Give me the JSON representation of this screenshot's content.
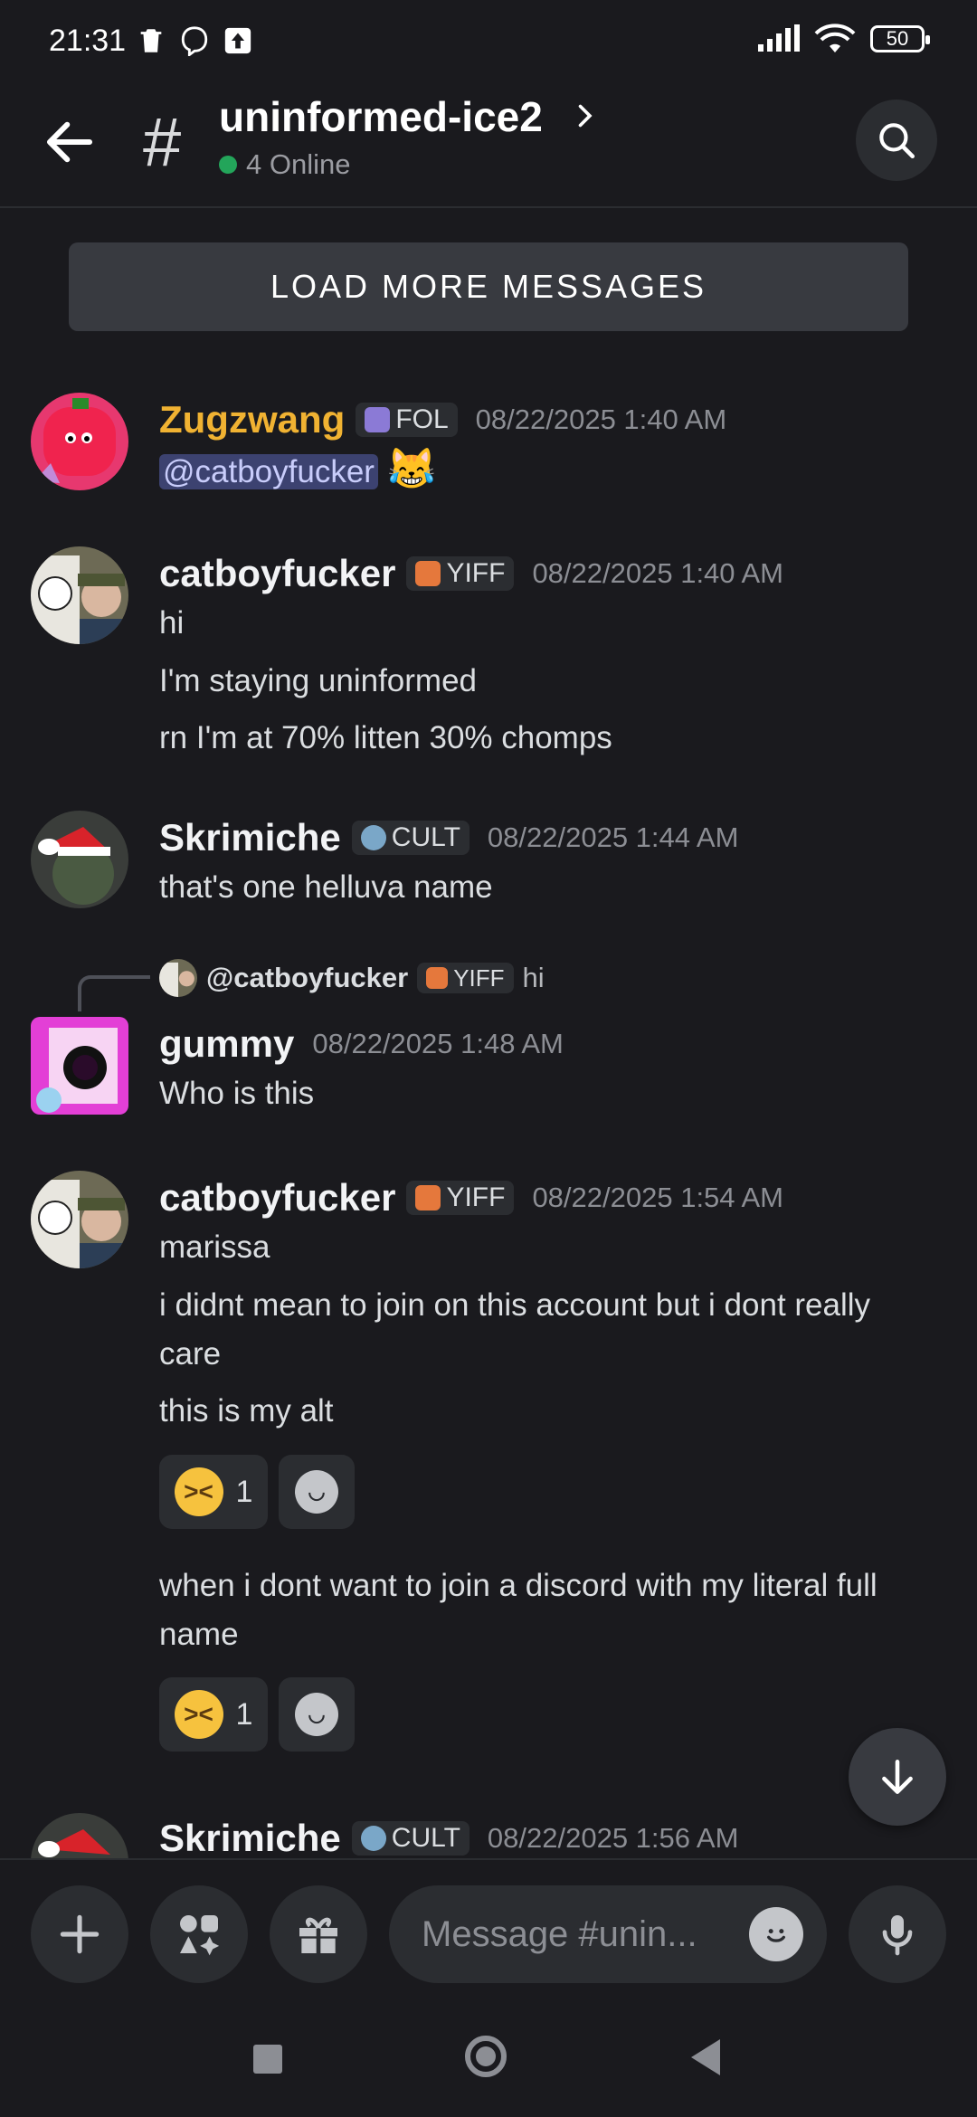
{
  "status": {
    "time": "21:31",
    "battery": "50"
  },
  "header": {
    "hash": "#",
    "channel": "uninformed-ice2",
    "online": "4 Online"
  },
  "load_more": "LOAD MORE MESSAGES",
  "messages": [
    {
      "user": "Zugzwang",
      "tag": "FOL",
      "time": "08/22/2025 1:40 AM",
      "mention": "@catboyfucker",
      "emoji": "😹"
    },
    {
      "user": "catboyfucker",
      "tag": "YIFF",
      "time": "08/22/2025 1:40 AM",
      "lines": [
        "hi",
        "I'm staying uninformed",
        "rn I'm at 70% litten 30% chomps"
      ]
    },
    {
      "user": "Skrimiche",
      "tag": "CULT",
      "time": "08/22/2025 1:44 AM",
      "lines": [
        "that's one helluva name"
      ]
    },
    {
      "reply_user": "@catboyfucker",
      "reply_tag": "YIFF",
      "reply_text": "hi",
      "user": "gummy",
      "time": "08/22/2025 1:48 AM",
      "lines": [
        "Who is this"
      ]
    },
    {
      "user": "catboyfucker",
      "tag": "YIFF",
      "time": "08/22/2025 1:54 AM",
      "lines": [
        "marissa",
        "i didnt mean to join on this account but i dont really care",
        "this is my alt"
      ],
      "reaction_count": "1",
      "lines2": [
        "when i dont want to join a discord with my literal full name"
      ],
      "reaction2_count": "1"
    },
    {
      "user": "Skrimiche",
      "tag": "CULT",
      "time": "08/22/2025 1:56 AM"
    }
  ],
  "composer": {
    "placeholder": "Message #unin..."
  },
  "colors": {
    "accent": "#5865f2",
    "online": "#23a55a",
    "gold_name": "#f0b232"
  }
}
